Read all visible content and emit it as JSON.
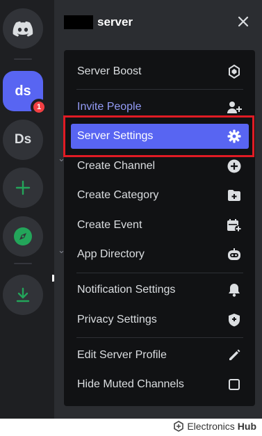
{
  "rail": {
    "servers": [
      {
        "label": "ds",
        "badge": "1"
      },
      {
        "label": "Ds"
      }
    ]
  },
  "header": {
    "server_name": "server"
  },
  "menu": {
    "items": [
      {
        "label": "Server Boost",
        "icon": "boost-icon"
      },
      {
        "label": "Invite People",
        "icon": "add-person-icon"
      },
      {
        "label": "Server Settings",
        "icon": "gear-icon"
      },
      {
        "label": "Create Channel",
        "icon": "plus-circle-icon"
      },
      {
        "label": "Create Category",
        "icon": "folder-plus-icon"
      },
      {
        "label": "Create Event",
        "icon": "calendar-plus-icon"
      },
      {
        "label": "App Directory",
        "icon": "robot-icon"
      },
      {
        "label": "Notification Settings",
        "icon": "bell-icon"
      },
      {
        "label": "Privacy Settings",
        "icon": "shield-icon"
      },
      {
        "label": "Edit Server Profile",
        "icon": "pencil-icon"
      },
      {
        "label": "Hide Muted Channels",
        "icon": "checkbox-icon"
      }
    ]
  },
  "watermark": {
    "brand": "Electronics",
    "brand_bold": "Hub"
  },
  "colors": {
    "blurple": "#5865f2",
    "invite": "#949cf7",
    "highlight_border": "#e01b24",
    "green": "#23a55a"
  }
}
